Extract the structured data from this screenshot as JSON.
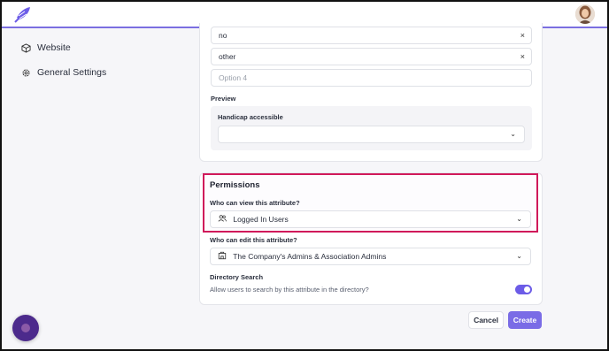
{
  "sidebar": {
    "items": [
      {
        "label": "Website",
        "icon": "cube-icon"
      },
      {
        "label": "General Settings",
        "icon": "gear-icon"
      }
    ]
  },
  "options": {
    "items": [
      {
        "value": "no"
      },
      {
        "value": "other"
      }
    ],
    "new_placeholder": "Option 4"
  },
  "preview": {
    "heading": "Preview",
    "field_label": "Handicap accessible",
    "selected": ""
  },
  "permissions": {
    "title": "Permissions",
    "view_label": "Who can view this attribute?",
    "view_value": "Logged In Users",
    "edit_label": "Who can edit this attribute?",
    "edit_value": "The Company's Admins & Association Admins",
    "search_label": "Directory Search",
    "search_help": "Allow users to search by this attribute in the directory?",
    "search_enabled": true
  },
  "actions": {
    "cancel": "Cancel",
    "create": "Create"
  },
  "colors": {
    "accent": "#7a6ce6",
    "highlight": "#d0195a"
  }
}
